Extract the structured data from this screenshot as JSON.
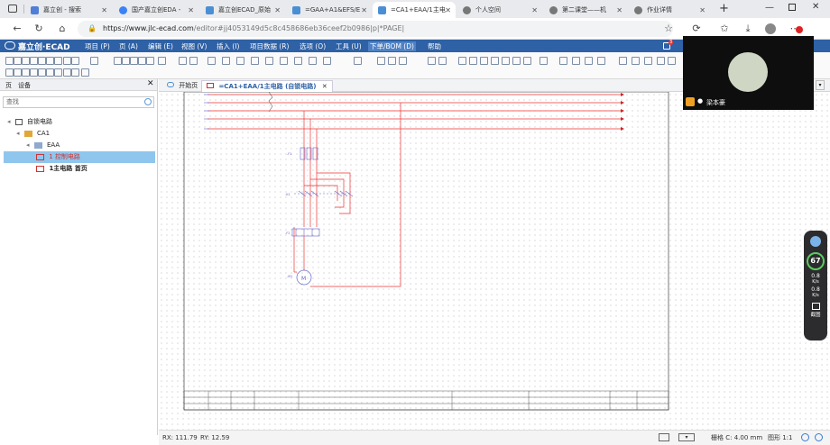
{
  "browser": {
    "tabs": [
      {
        "label": "嘉立创 - 搜索",
        "color": "#4f7fd6"
      },
      {
        "label": "国产嘉立创EDA - ",
        "color": "#3b82f6"
      },
      {
        "label": "嘉立创ECAD_原始",
        "color": "#4a8fd4"
      },
      {
        "label": "=GAA+A1&EFS/E",
        "color": "#4a8fd4"
      },
      {
        "label": "=CA1+EAA/1主电",
        "color": "#4a8fd4"
      },
      {
        "label": "个人空间",
        "color": "#777777"
      },
      {
        "label": "第二课堂——机",
        "color": "#777777"
      },
      {
        "label": "作业详情",
        "color": "#777777"
      }
    ],
    "new_tab": "+",
    "url_host": "https://www.jlc-ecad.com",
    "url_path": "/editor#jj4053149d5c8c458686eb36ceef2b0986|p|*PAGE|",
    "menu_badge": "3"
  },
  "app": {
    "logo": "嘉立创·ECAD",
    "menus": [
      "项目 (P)",
      "页 (A)",
      "编辑 (E)",
      "视图 (V)",
      "插入 (I)",
      "项目数据 (R)",
      "选项 (O)",
      "工具 (U)",
      "下单/BOM (D)",
      "帮助"
    ],
    "brand_color": "#2e61a5"
  },
  "left_panel": {
    "tabs": [
      "页",
      "设备"
    ],
    "search_placeholder": "查找",
    "tree": [
      {
        "label": "自锁电路",
        "level": 0
      },
      {
        "label": "CA1",
        "level": 1
      },
      {
        "label": "EAA",
        "level": 2
      },
      {
        "label": "1 控制电路",
        "level": 3,
        "selected": true
      },
      {
        "label": "1主电路 首页",
        "level": 3,
        "bold": true
      }
    ]
  },
  "doc_tabs": [
    {
      "label": "开始页",
      "active": false
    },
    {
      "label": "=CA1+EAA/1主电路 (自锁电路)",
      "active": true
    }
  ],
  "status": {
    "rx": "RX: 111.79",
    "ry": "RY: 12.59",
    "grid": "栅格 C: 4.00 mm",
    "shape": "图形 1:1"
  },
  "video": {
    "name": "梁本豪"
  },
  "speed_widget": {
    "value": "67",
    "up": "0.8",
    "up_unit": "K/s",
    "down": "0.8",
    "down_unit": "K/s",
    "label": "截图"
  }
}
